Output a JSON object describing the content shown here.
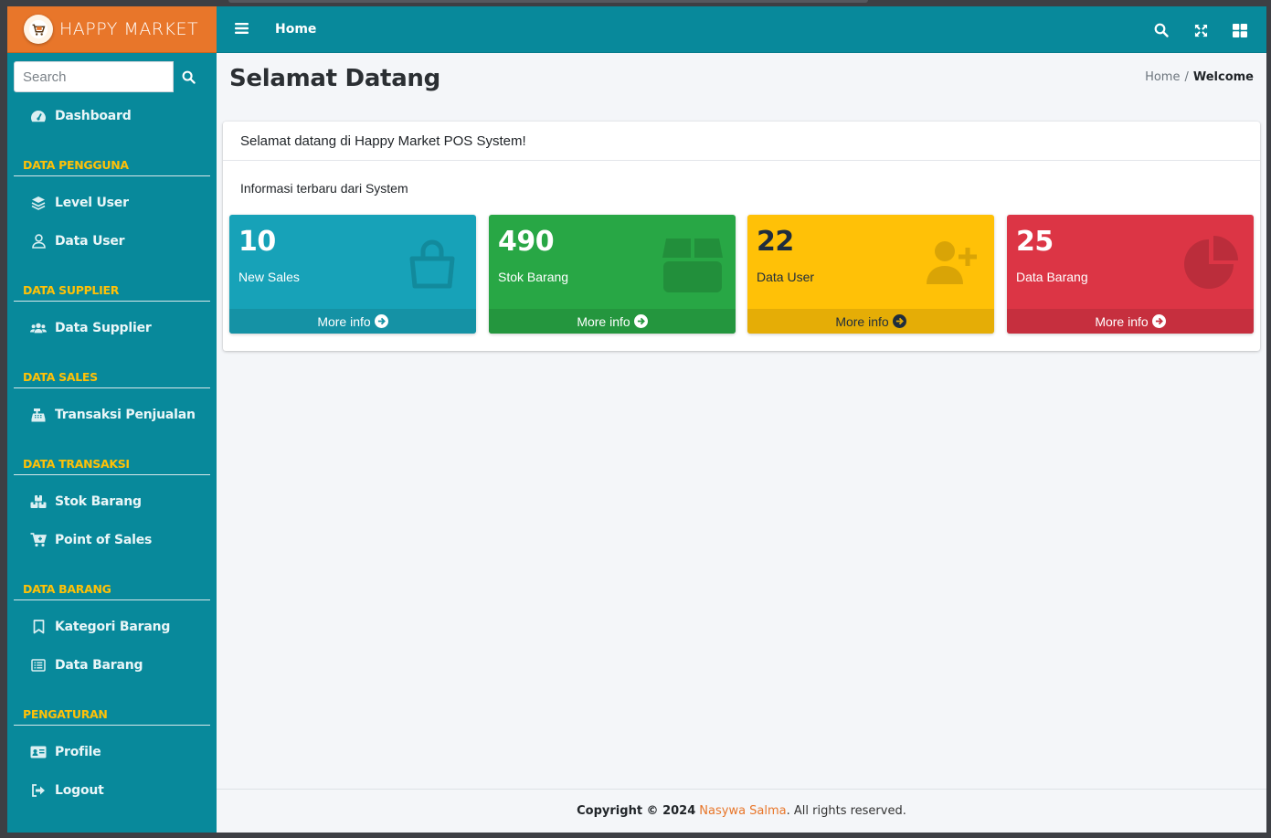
{
  "brand": {
    "name": "HAPPY MARKET",
    "logo_icon": "cart-logo-icon"
  },
  "search": {
    "placeholder": "Search"
  },
  "sidebar": {
    "items": [
      {
        "type": "item",
        "label": "Dashboard",
        "icon": "tachometer-icon"
      },
      {
        "type": "header",
        "label": "DATA PENGGUNA"
      },
      {
        "type": "item",
        "label": "Level User",
        "icon": "layer-group-icon"
      },
      {
        "type": "item",
        "label": "Data User",
        "icon": "user-icon"
      },
      {
        "type": "header",
        "label": "DATA SUPPLIER"
      },
      {
        "type": "item",
        "label": "Data Supplier",
        "icon": "users-icon"
      },
      {
        "type": "header",
        "label": "DATA SALES"
      },
      {
        "type": "item",
        "label": "Transaksi Penjualan",
        "icon": "cash-register-icon"
      },
      {
        "type": "header",
        "label": "DATA TRANSAKSI"
      },
      {
        "type": "item",
        "label": "Stok Barang",
        "icon": "boxes-icon"
      },
      {
        "type": "item",
        "label": "Point of Sales",
        "icon": "cart-plus-icon"
      },
      {
        "type": "header",
        "label": "DATA BARANG"
      },
      {
        "type": "item",
        "label": "Kategori Barang",
        "icon": "bookmark-icon"
      },
      {
        "type": "item",
        "label": "Data Barang",
        "icon": "list-alt-icon"
      },
      {
        "type": "header",
        "label": "PENGATURAN"
      },
      {
        "type": "item",
        "label": "Profile",
        "icon": "id-card-icon"
      },
      {
        "type": "item",
        "label": "Logout",
        "icon": "sign-out-icon"
      }
    ]
  },
  "navbar": {
    "home_label": "Home"
  },
  "header": {
    "title": "Selamat Datang"
  },
  "breadcrumb": {
    "home": "Home",
    "separator": "/",
    "current": "Welcome"
  },
  "card": {
    "title": "Selamat datang di Happy Market POS System!",
    "subtitle": "Informasi terbaru dari System"
  },
  "boxes": [
    {
      "value": "10",
      "label": "New Sales",
      "more": "More info",
      "color": "#17a2b8",
      "icon": "shopping-bag-icon"
    },
    {
      "value": "490",
      "label": "Stok Barang",
      "more": "More info",
      "color": "#28a745",
      "icon": "box-icon"
    },
    {
      "value": "22",
      "label": "Data User",
      "more": "More info",
      "color": "#ffc107",
      "icon": "user-plus-icon"
    },
    {
      "value": "25",
      "label": "Data Barang",
      "more": "More info",
      "color": "#dc3545",
      "icon": "chart-pie-icon"
    }
  ],
  "footer": {
    "prefix": "Copyright © 2024",
    "author": "Nasywa Salma",
    "suffix": ". All rights reserved."
  }
}
